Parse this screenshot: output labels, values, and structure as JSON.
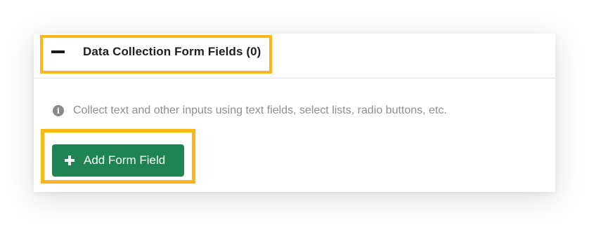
{
  "section": {
    "title": "Data Collection Form Fields (0)",
    "collapse_icon": "minus-icon",
    "info_icon": "info-circle-icon",
    "info_text": "Collect text and other inputs using text fields, select lists, radio buttons, etc.",
    "add_button_label": "Add Form Field",
    "add_button_icon": "plus-icon"
  },
  "colors": {
    "highlight": "#fbb814",
    "button": "#1e8552",
    "info_text": "#8e8e8e",
    "title": "#1f1f1f"
  }
}
